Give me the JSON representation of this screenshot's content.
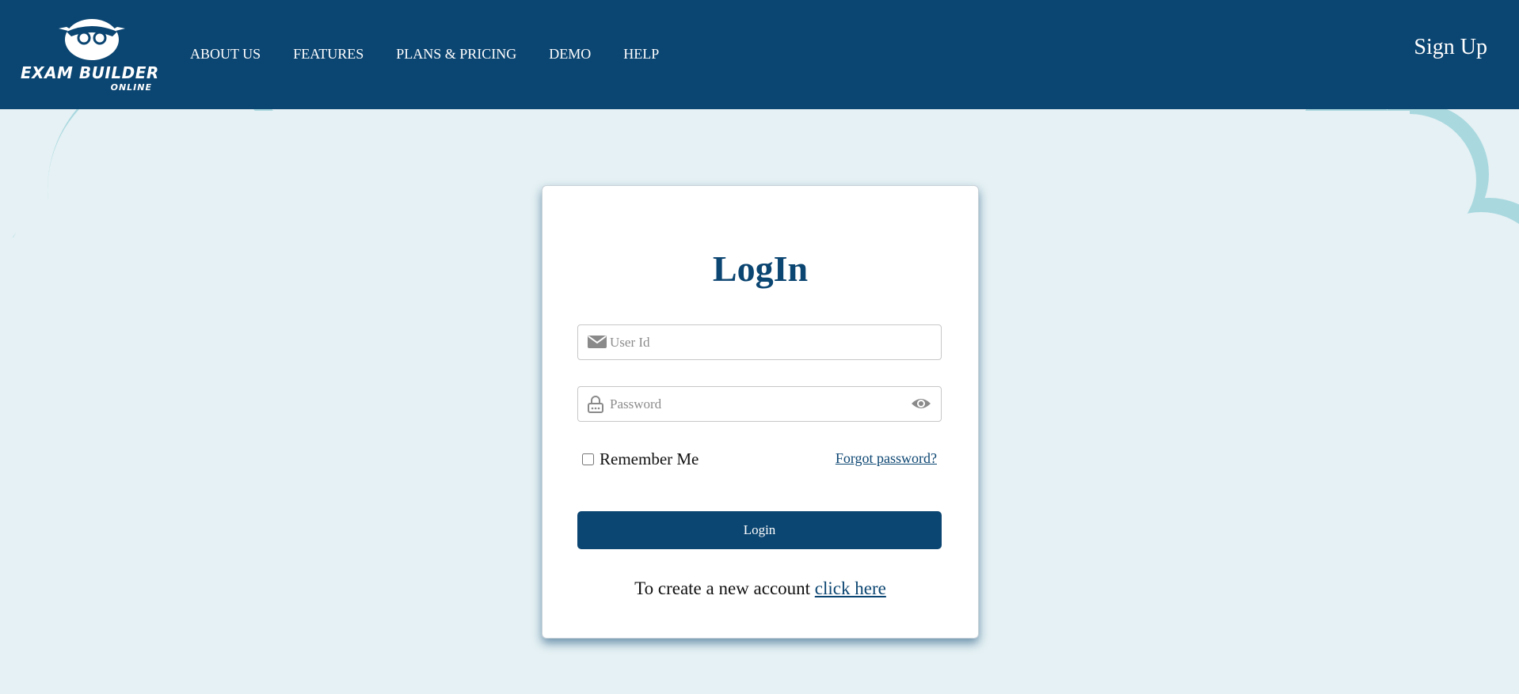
{
  "brand": {
    "logo_main": "EXAM BUILDER",
    "logo_sub": "ONLINE"
  },
  "nav": {
    "items": [
      {
        "label": "ABOUT US"
      },
      {
        "label": "FEATURES"
      },
      {
        "label": "PLANS & PRICING"
      },
      {
        "label": "DEMO"
      },
      {
        "label": "HELP"
      }
    ],
    "signup_label": "Sign Up"
  },
  "login": {
    "title": "LogIn",
    "user_placeholder": "User Id",
    "password_placeholder": "Password",
    "remember_label": "Remember Me",
    "forgot_label": "Forgot password?",
    "button_label": "Login",
    "create_text": "To create a new account",
    "create_link": "click here"
  },
  "icons": {
    "user_field": "envelope-icon",
    "password_field": "lock-icon",
    "show_password": "eye-icon"
  },
  "colors": {
    "brand": "#0b4571",
    "background": "#e5f1f4",
    "clouds": "#a9d8df"
  }
}
